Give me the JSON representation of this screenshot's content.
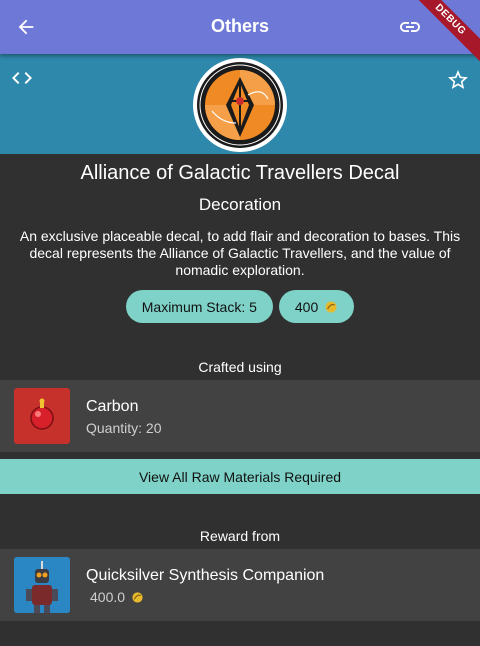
{
  "app_bar": {
    "title": "Others"
  },
  "debug_banner": "DEBUG",
  "item": {
    "name": "Alliance of Galactic Travellers Decal",
    "category": "Decoration",
    "description": "An exclusive placeable decal, to add flair and decoration to bases. This decal represents the Alliance of Galactic Travellers, and the value of nomadic exploration.",
    "max_stack": "Maximum Stack: 5",
    "value": "400"
  },
  "crafted": {
    "heading": "Crafted using",
    "items": [
      {
        "name": "Carbon",
        "quantity": "Quantity: 20"
      }
    ],
    "view_all_label": "View All Raw Materials Required"
  },
  "reward": {
    "heading": "Reward from",
    "items": [
      {
        "name": "Quicksilver Synthesis Companion",
        "value": "400.0"
      }
    ]
  },
  "colors": {
    "app_bar": "#6e78d6",
    "hero": "#2e88ab",
    "background": "#303030",
    "card": "#424242",
    "accent_chip": "#7fd2c8",
    "carbon_tile": "#c6312c",
    "reward_tile": "#2a87c4",
    "debug_ribbon": "#a6182a"
  },
  "icons": {
    "back": "arrow-back-icon",
    "link": "link-icon",
    "more": "more-vert-icon",
    "code": "code-icon",
    "favourite": "star-outline-icon",
    "currency": "quicksilver-coin-icon"
  }
}
